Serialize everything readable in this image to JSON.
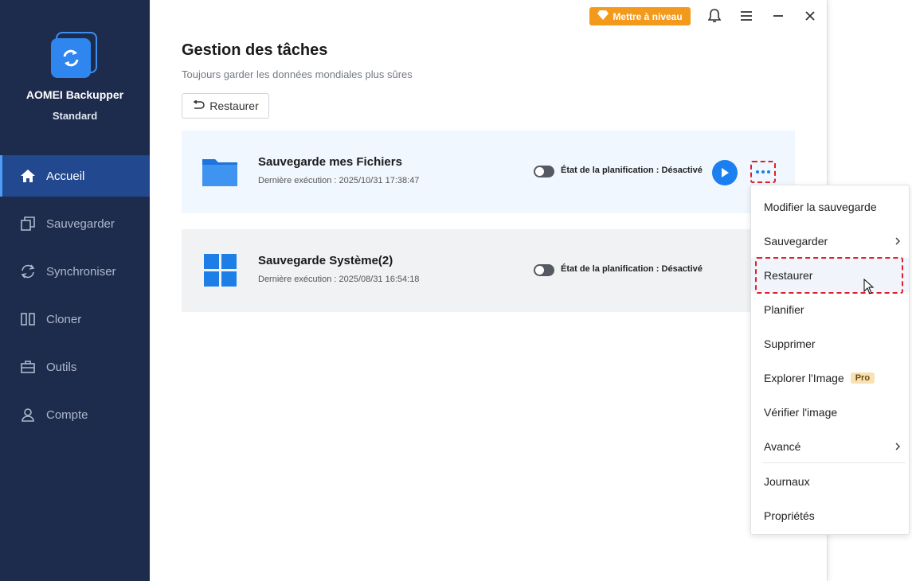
{
  "app": {
    "name": "AOMEI Backupper",
    "edition": "Standard"
  },
  "topbar": {
    "upgrade_label": "Mettre à niveau"
  },
  "sidebar": {
    "items": [
      {
        "label": "Accueil",
        "icon": "home-icon"
      },
      {
        "label": "Sauvegarder",
        "icon": "backup-icon"
      },
      {
        "label": "Synchroniser",
        "icon": "sync-icon"
      },
      {
        "label": "Cloner",
        "icon": "clone-icon"
      },
      {
        "label": "Outils",
        "icon": "toolbox-icon"
      },
      {
        "label": "Compte",
        "icon": "user-icon"
      }
    ]
  },
  "main": {
    "title": "Gestion des tâches",
    "subtitle": "Toujours garder les données mondiales plus sûres",
    "restore_label": "Restaurer",
    "tasks": [
      {
        "name": "Sauvegarde mes Fichiers",
        "last_run": "Dernière exécution : 2025/10/31 17:38:47",
        "schedule": "État de la planification : Désactivé",
        "icon": "folder-icon"
      },
      {
        "name": "Sauvegarde Système(2)",
        "last_run": "Dernière exécution : 2025/08/31 16:54:18",
        "schedule": "État de la planification : Désactivé",
        "icon": "windows-icon"
      }
    ]
  },
  "context_menu": {
    "items": [
      {
        "label": "Modifier la sauvegarde"
      },
      {
        "label": "Sauvegarder"
      },
      {
        "label": "Restaurer"
      },
      {
        "label": "Planifier"
      },
      {
        "label": "Supprimer"
      },
      {
        "label": "Explorer l'Image",
        "badge": "Pro"
      },
      {
        "label": "Vérifier l'image"
      },
      {
        "label": "Avancé"
      },
      {
        "label": "Journaux"
      },
      {
        "label": "Propriétés"
      }
    ]
  },
  "colors": {
    "sidebar_bg": "#1d2b4d",
    "sidebar_active": "#22488f",
    "accent": "#1a7ff0",
    "upgrade": "#f39a1c",
    "highlight_border": "#e0202a"
  }
}
